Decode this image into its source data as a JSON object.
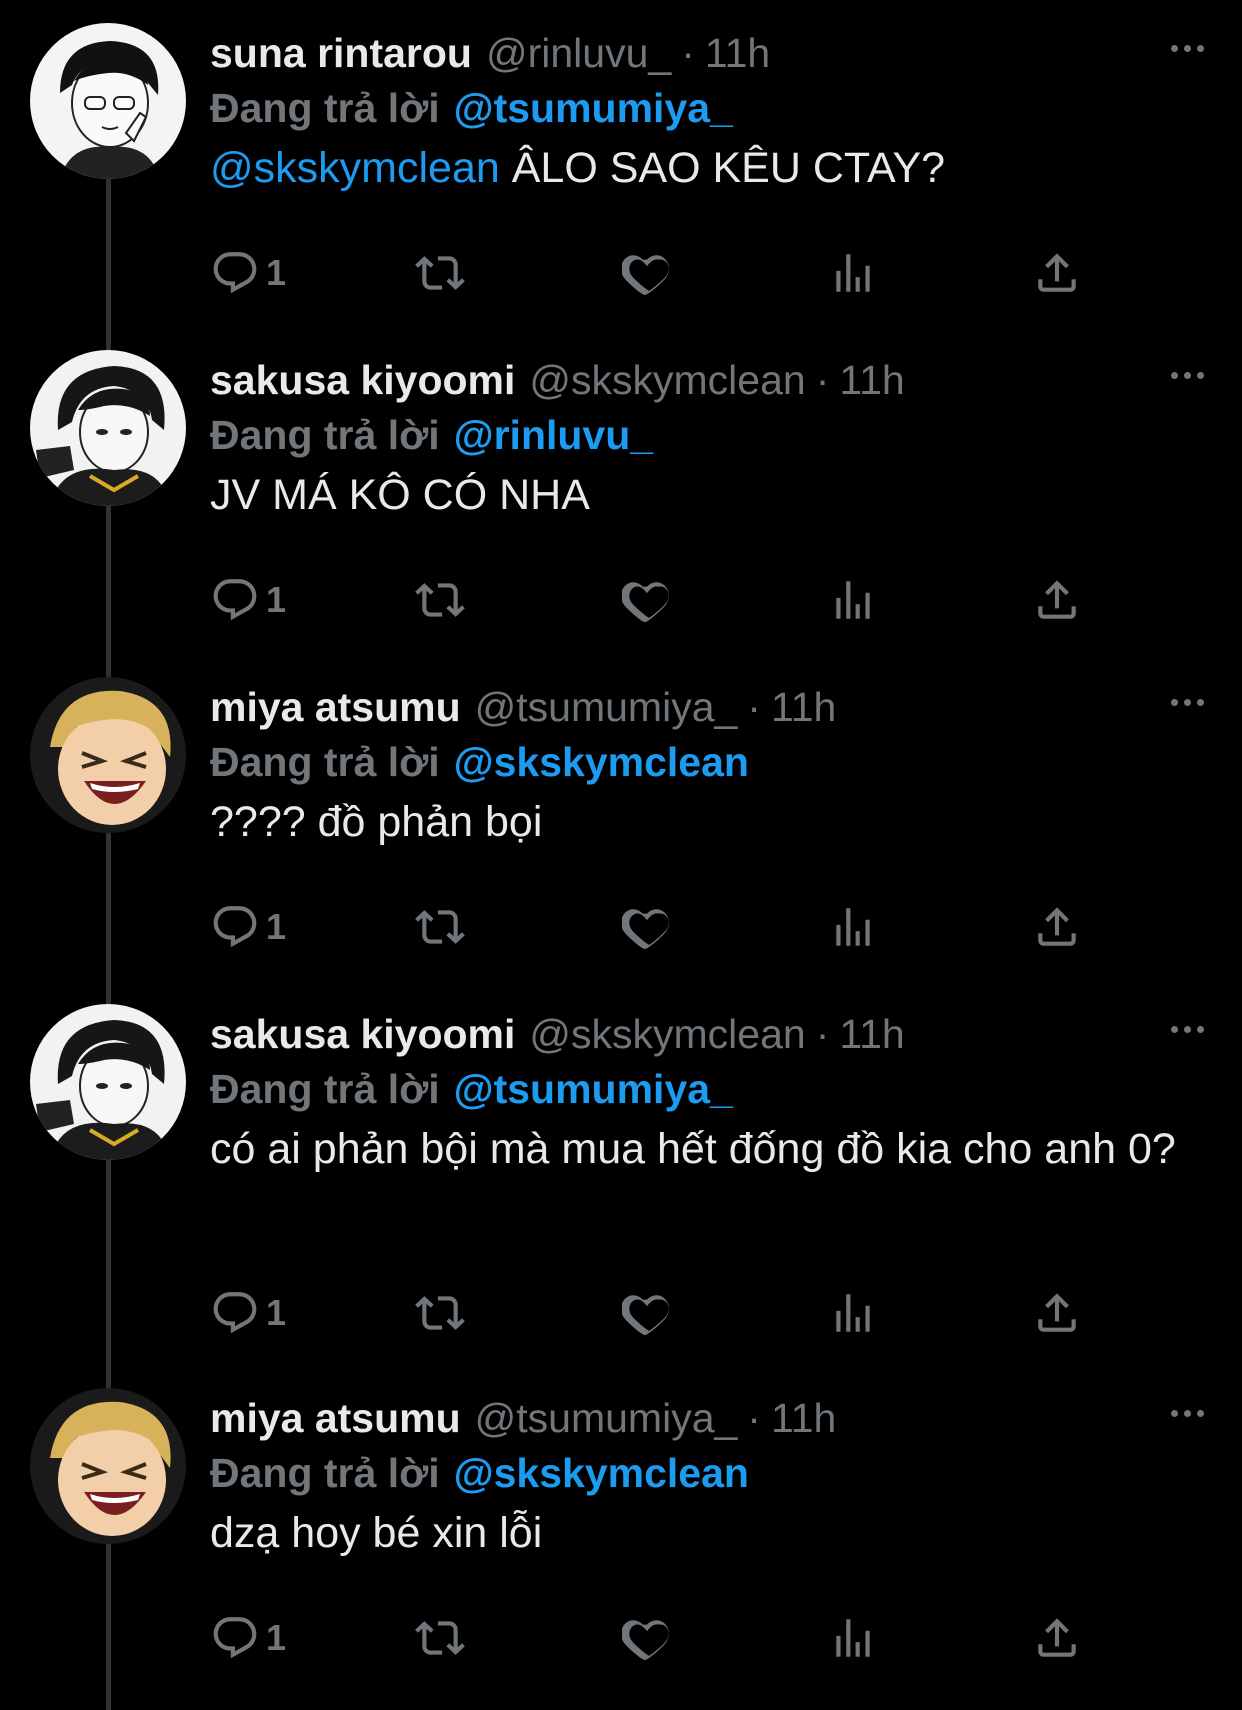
{
  "reply_prefix": "Đang trả lời",
  "tweets": [
    {
      "name": "suna rintarou",
      "handle": "@rinluvu_",
      "time": "11h",
      "reply_to": "@tsumumiya_",
      "mention": "@skskymclean",
      "text": " ÂLO SAO KÊU CTAY?",
      "reply_count": "1",
      "avatar": "suna-avatar"
    },
    {
      "name": "sakusa kiyoomi",
      "handle": "@skskymclean",
      "time": "11h",
      "reply_to": "@rinluvu_",
      "mention": "",
      "text": "JV MÁ KÔ CÓ NHA",
      "reply_count": "1",
      "avatar": "sakusa-avatar"
    },
    {
      "name": "miya atsumu",
      "handle": "@tsumumiya_",
      "time": "11h",
      "reply_to": "@skskymclean",
      "mention": "",
      "text": "???? đồ phản bọi",
      "reply_count": "1",
      "avatar": "atsumu-avatar"
    },
    {
      "name": "sakusa kiyoomi",
      "handle": "@skskymclean",
      "time": "11h",
      "reply_to": "@tsumumiya_",
      "mention": "",
      "text": "có ai phản bội mà mua hết đống đồ kia cho anh 0?",
      "reply_count": "1",
      "avatar": "sakusa-avatar"
    },
    {
      "name": "miya atsumu",
      "handle": "@tsumumiya_",
      "time": "11h",
      "reply_to": "@skskymclean",
      "mention": "",
      "text": "dzạ hoy bé xin lỗi",
      "reply_count": "1",
      "avatar": "atsumu-avatar"
    }
  ],
  "colors": {
    "background": "#000000",
    "text": "#e7e9ea",
    "secondary": "#71767b",
    "link": "#1d9bf0"
  },
  "icons": [
    "reply-icon",
    "retweet-icon",
    "like-icon",
    "views-icon",
    "share-icon",
    "more-icon"
  ]
}
